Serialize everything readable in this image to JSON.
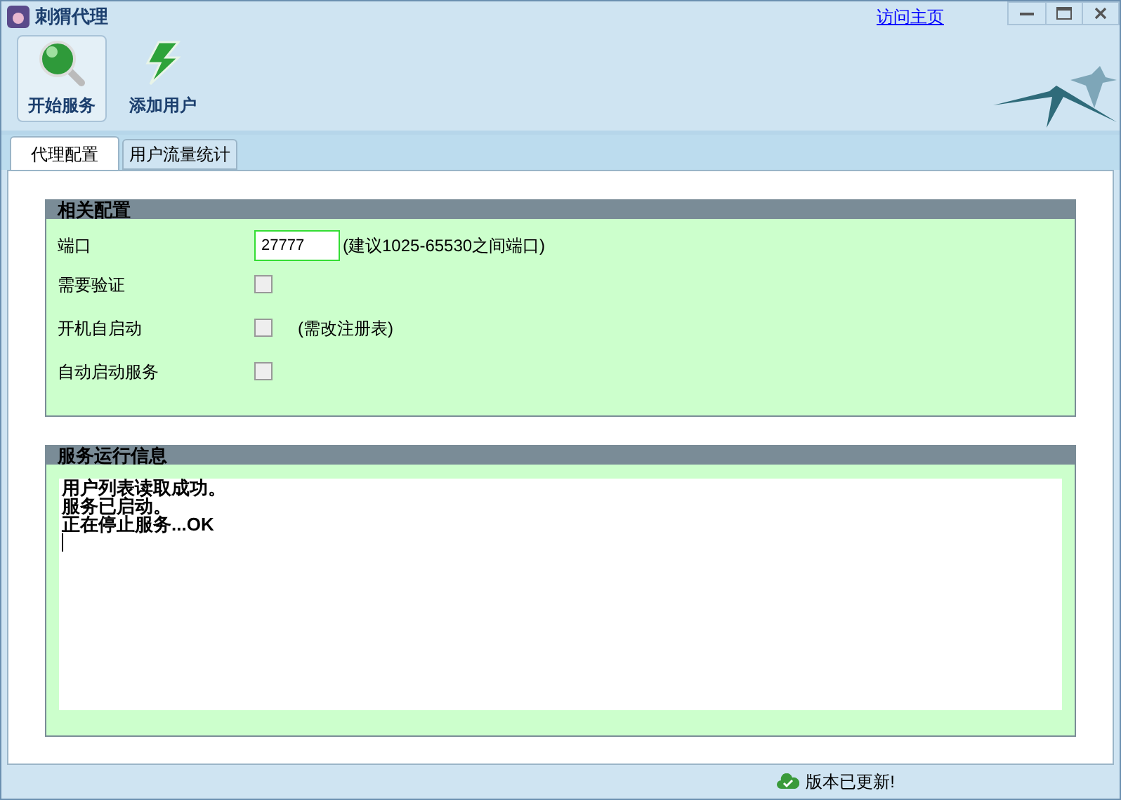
{
  "window": {
    "title": "刺猬代理",
    "link": "访问主页"
  },
  "toolbar": [
    {
      "label": "开始服务",
      "kind": "search",
      "selected": true
    },
    {
      "label": "添加用户",
      "kind": "bolt",
      "selected": false
    }
  ],
  "tabs": [
    {
      "label": "代理配置",
      "selected": true
    },
    {
      "label": "用户流量统计",
      "selected": false
    }
  ],
  "config": {
    "title": "相关配置",
    "port_label": "端口",
    "port_value": "27777",
    "port_hint": "(建议1025-65530之间端口)",
    "options": [
      {
        "label": "需要验证",
        "checked": false
      },
      {
        "label": "开机自启动",
        "checked": false,
        "note": "(需改注册表)"
      },
      {
        "label": "自动启动服务",
        "checked": false
      }
    ]
  },
  "log": {
    "title": "服务运行信息",
    "lines": [
      "用户列表读取成功。",
      "服务已启动。",
      "正在停止服务...OK"
    ]
  },
  "status_bar": {
    "message": "版本已更新!"
  }
}
